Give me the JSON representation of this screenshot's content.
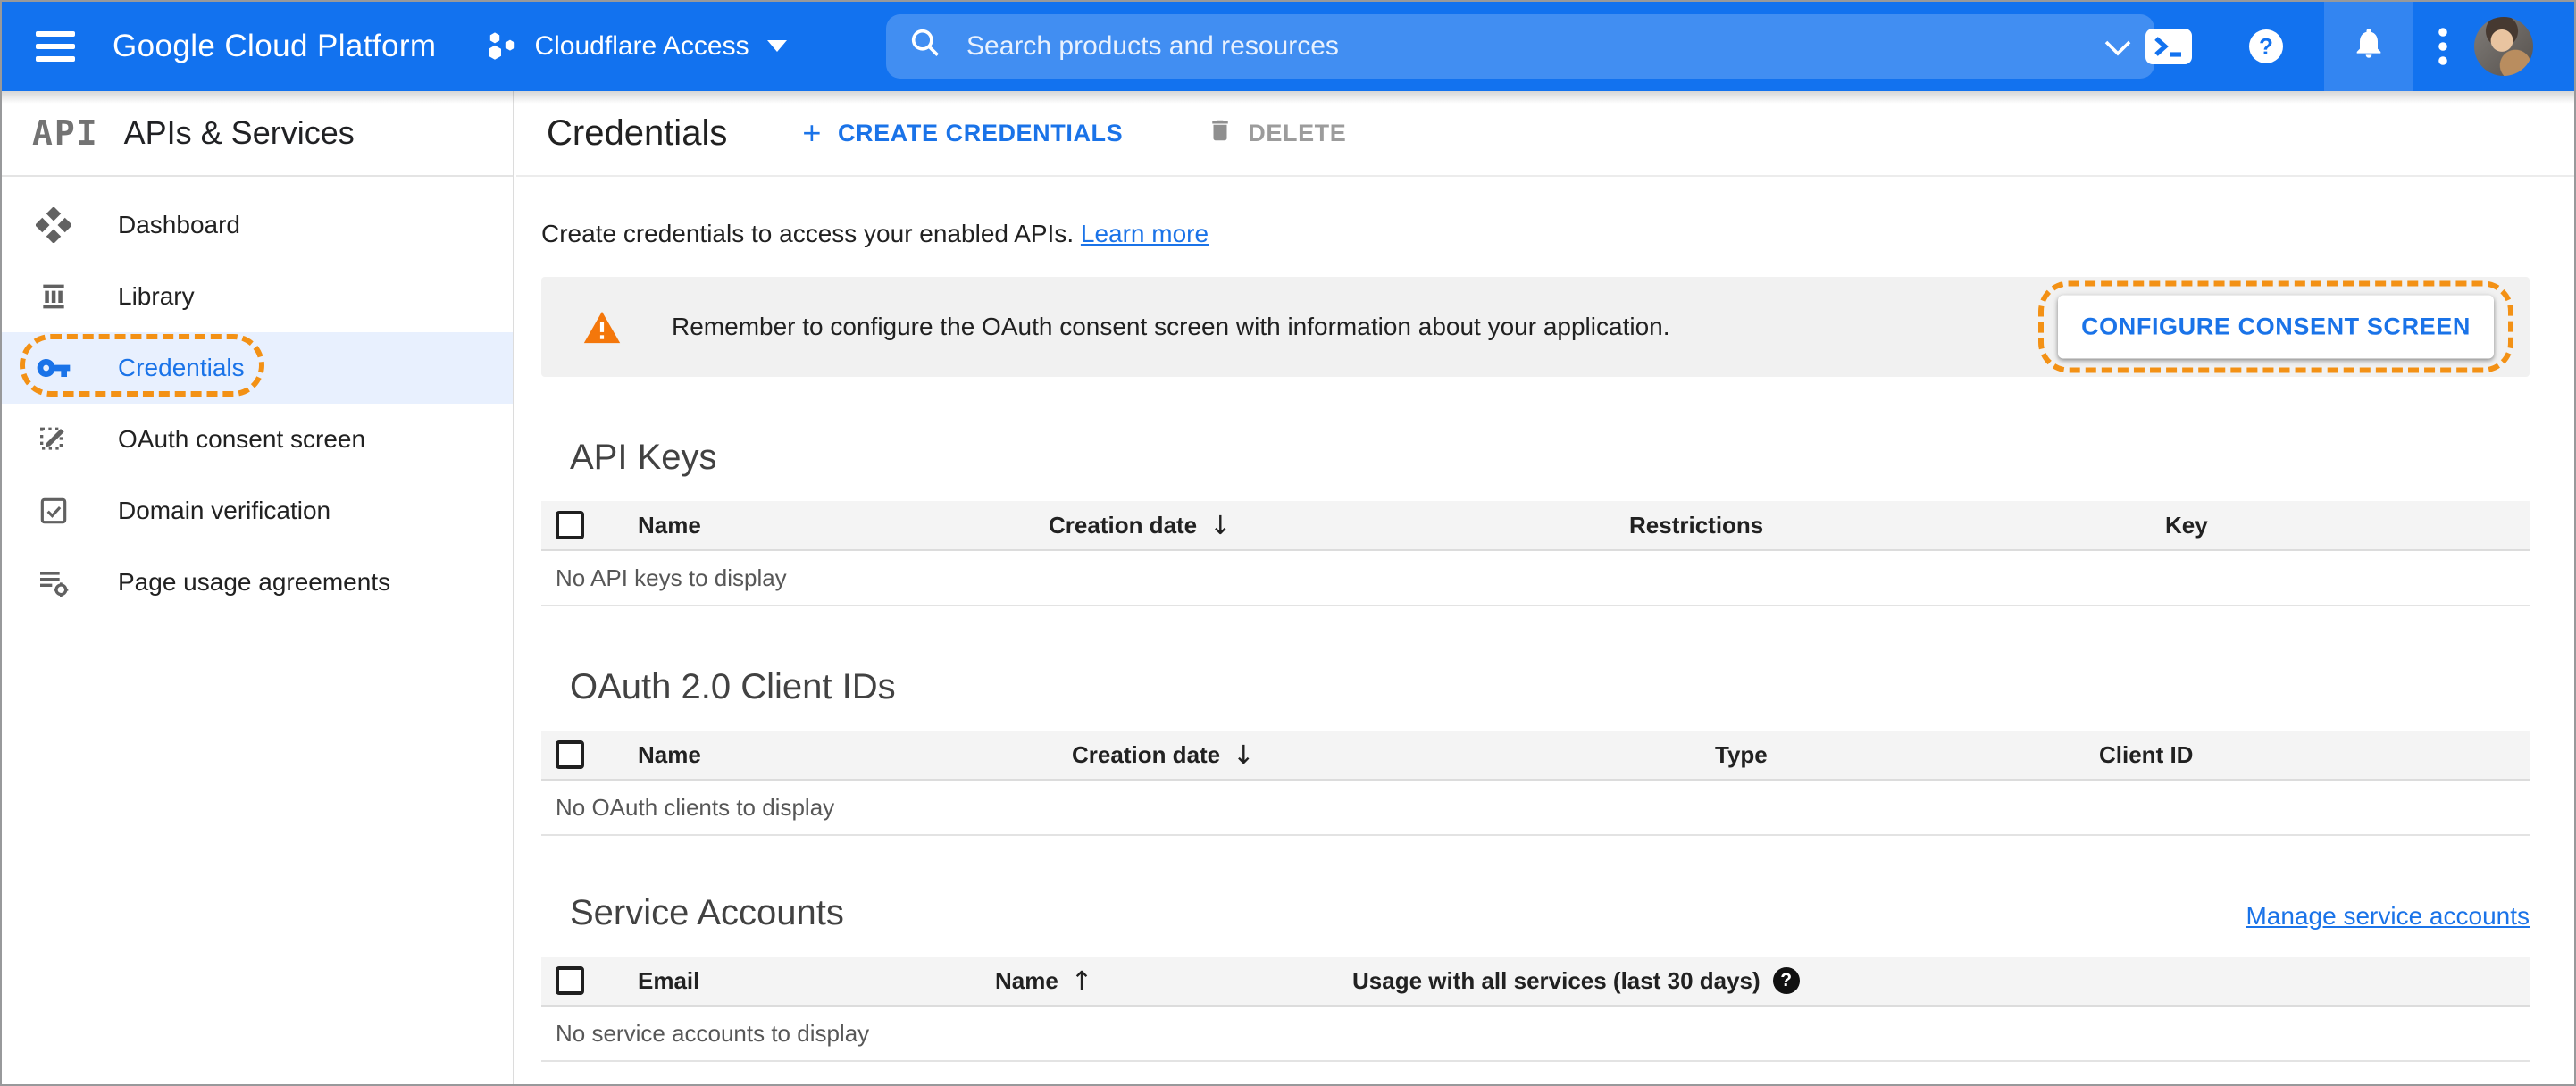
{
  "colors": {
    "topbar_blue": "#1272ef",
    "accent_blue": "#1a73e8",
    "annotation_orange": "#f39115",
    "warning_orange": "#f4770b",
    "banner_gray": "#f1f1f1",
    "active_item_bg": "#e8f0fe"
  },
  "topbar": {
    "product_name": "Google Cloud Platform",
    "project_name": "Cloudflare Access",
    "search_placeholder": "Search products and resources"
  },
  "sidebar": {
    "logo_text": "API",
    "title": "APIs & Services",
    "items": [
      {
        "label": "Dashboard",
        "active": false
      },
      {
        "label": "Library",
        "active": false
      },
      {
        "label": "Credentials",
        "active": true
      },
      {
        "label": "OAuth consent screen",
        "active": false
      },
      {
        "label": "Domain verification",
        "active": false
      },
      {
        "label": "Page usage agreements",
        "active": false
      }
    ]
  },
  "page": {
    "title": "Credentials",
    "create_button": "CREATE CREDENTIALS",
    "delete_button": "DELETE",
    "intro_text": "Create credentials to access your enabled APIs.",
    "intro_link": "Learn more",
    "banner": {
      "message": "Remember to configure the OAuth consent screen with information about your application.",
      "button": "CONFIGURE CONSENT SCREEN"
    }
  },
  "glyphs": {
    "plus": "+",
    "sort_desc": "↓",
    "sort_asc": "↑",
    "help": "?"
  },
  "tables": {
    "api_keys": {
      "title": "API Keys",
      "columns": [
        "Name",
        "Creation date",
        "Restrictions",
        "Key"
      ],
      "sort_column": "Creation date",
      "sort_direction": "descending",
      "empty": "No API keys to display"
    },
    "oauth_clients": {
      "title": "OAuth 2.0 Client IDs",
      "columns": [
        "Name",
        "Creation date",
        "Type",
        "Client ID"
      ],
      "sort_column": "Creation date",
      "sort_direction": "descending",
      "empty": "No OAuth clients to display"
    },
    "service_accounts": {
      "title": "Service Accounts",
      "manage_link": "Manage service accounts",
      "columns": [
        "Email",
        "Name",
        "Usage with all services (last 30 days)"
      ],
      "sort_column": "Name",
      "sort_direction": "ascending",
      "empty": "No service accounts to display"
    }
  }
}
